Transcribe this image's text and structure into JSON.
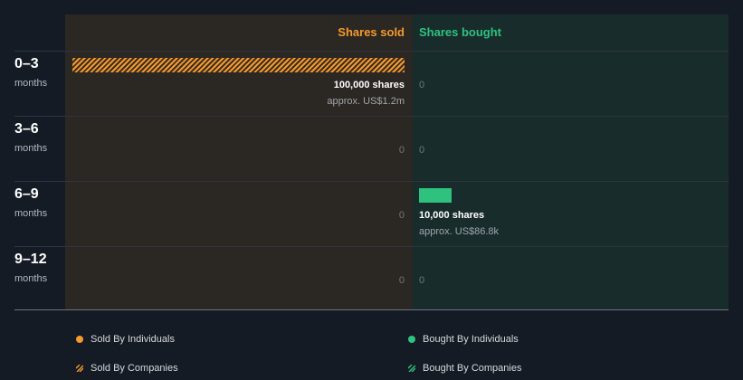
{
  "chart_data": {
    "type": "bar",
    "orientation": "horizontal-diverging",
    "columns": {
      "sold_label": "Shares sold",
      "bought_label": "Shares bought"
    },
    "periods": [
      {
        "range": "0–3",
        "unit": "months"
      },
      {
        "range": "3–6",
        "unit": "months"
      },
      {
        "range": "6–9",
        "unit": "months"
      },
      {
        "range": "9–12",
        "unit": "months"
      }
    ],
    "series": [
      {
        "name": "Sold By Individuals",
        "side": "sold",
        "values": [
          0,
          0,
          0,
          0
        ],
        "color": "#f59a2f",
        "pattern": "solid"
      },
      {
        "name": "Sold By Companies",
        "side": "sold",
        "values": [
          100000,
          0,
          0,
          0
        ],
        "color": "#f59a2f",
        "pattern": "hatched"
      },
      {
        "name": "Bought By Individuals",
        "side": "bought",
        "values": [
          0,
          0,
          10000,
          0
        ],
        "color": "#2ec27e",
        "pattern": "solid"
      },
      {
        "name": "Bought By Companies",
        "side": "bought",
        "values": [
          0,
          0,
          0,
          0
        ],
        "color": "#2ec27e",
        "pattern": "hatched"
      }
    ],
    "labels": {
      "sold": [
        {
          "shares": "100,000 shares",
          "approx": "approx. US$1.2m"
        },
        {
          "zero": "0"
        },
        {
          "zero": "0"
        },
        {
          "zero": "0"
        }
      ],
      "bought": [
        {
          "zero": "0"
        },
        {
          "zero": "0"
        },
        {
          "shares": "10,000 shares",
          "approx": "approx. US$86.8k"
        },
        {
          "zero": "0"
        }
      ]
    },
    "max_value": 100000,
    "legend": [
      {
        "label": "Sold By Individuals",
        "color": "#f59a2f",
        "marker": "dot"
      },
      {
        "label": "Bought By Individuals",
        "color": "#2ec27e",
        "marker": "dot"
      },
      {
        "label": "Sold By Companies",
        "color": "#f59a2f",
        "marker": "hatch"
      },
      {
        "label": "Bought By Companies",
        "color": "#2ec27e",
        "marker": "hatch"
      }
    ]
  }
}
